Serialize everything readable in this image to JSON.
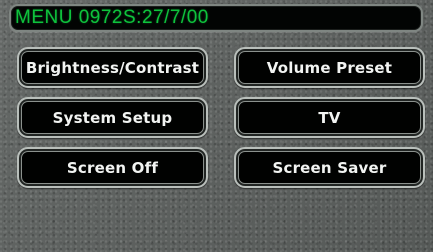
{
  "header": {
    "title": "MENU 0972S:27/7/00"
  },
  "menu": {
    "buttons": [
      {
        "label": "Brightness/Contrast"
      },
      {
        "label": "Volume Preset"
      },
      {
        "label": "System Setup"
      },
      {
        "label": "TV"
      },
      {
        "label": "Screen Off"
      },
      {
        "label": "Screen Saver"
      }
    ]
  },
  "colors": {
    "title_text": "#0ec33c",
    "background": "#5d615f",
    "button_face": "#010201",
    "button_border": "#b9bfbb",
    "button_text": "#f2f4f2"
  }
}
